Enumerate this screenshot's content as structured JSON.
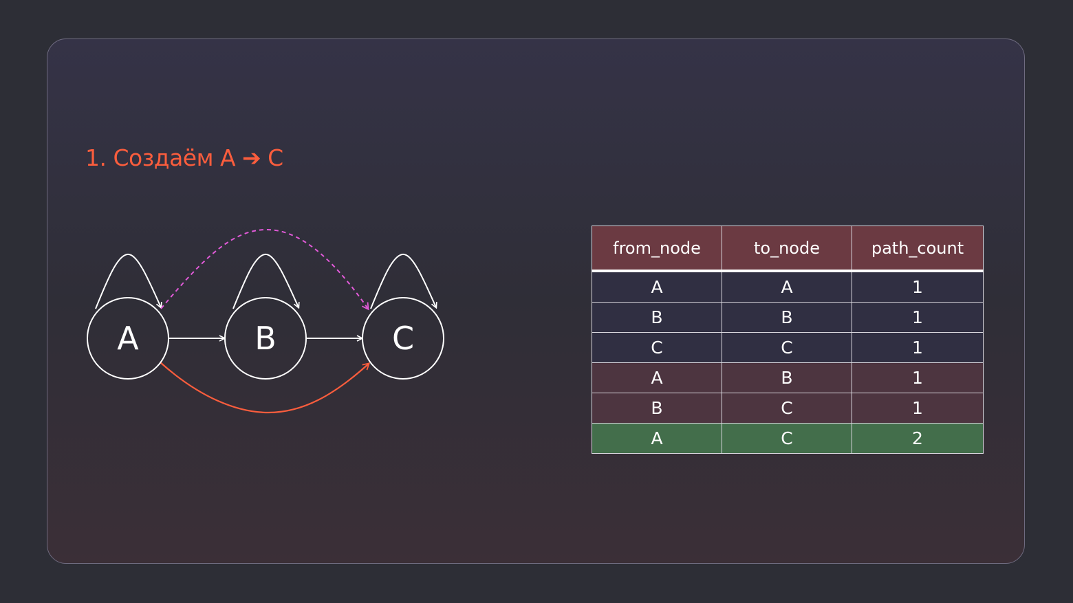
{
  "title": "1. Создаём A ➔ C",
  "graph": {
    "nodes": [
      {
        "id": "A",
        "label": "A"
      },
      {
        "id": "B",
        "label": "B"
      },
      {
        "id": "C",
        "label": "C"
      }
    ],
    "edges": [
      {
        "from": "A",
        "to": "A",
        "style": "self-loop",
        "color": "#ffffff"
      },
      {
        "from": "B",
        "to": "B",
        "style": "self-loop",
        "color": "#ffffff"
      },
      {
        "from": "C",
        "to": "C",
        "style": "self-loop",
        "color": "#ffffff"
      },
      {
        "from": "A",
        "to": "B",
        "style": "solid",
        "color": "#ffffff"
      },
      {
        "from": "B",
        "to": "C",
        "style": "solid",
        "color": "#ffffff"
      },
      {
        "from": "A",
        "to": "C",
        "style": "curved-solid",
        "color": "#fb5d3d"
      },
      {
        "from": "A",
        "to": "C",
        "style": "curved-dashed",
        "color": "#e15ad8"
      }
    ]
  },
  "table": {
    "headers": [
      "from_node",
      "to_node",
      "path_count"
    ],
    "rows": [
      {
        "from_node": "A",
        "to_node": "A",
        "path_count": "1",
        "highlight": "base"
      },
      {
        "from_node": "B",
        "to_node": "B",
        "path_count": "1",
        "highlight": "base"
      },
      {
        "from_node": "C",
        "to_node": "C",
        "path_count": "1",
        "highlight": "base"
      },
      {
        "from_node": "A",
        "to_node": "B",
        "path_count": "1",
        "highlight": "derived"
      },
      {
        "from_node": "B",
        "to_node": "C",
        "path_count": "1",
        "highlight": "derived"
      },
      {
        "from_node": "A",
        "to_node": "C",
        "path_count": "2",
        "highlight": "new"
      }
    ]
  },
  "colors": {
    "accent": "#fb5d3d",
    "dashed_edge": "#e15ad8",
    "header_bg": "#6b3a42",
    "base_row_bg": "#302f42",
    "derived_row_bg": "#4d3540",
    "new_row_bg": "#436e4b"
  }
}
